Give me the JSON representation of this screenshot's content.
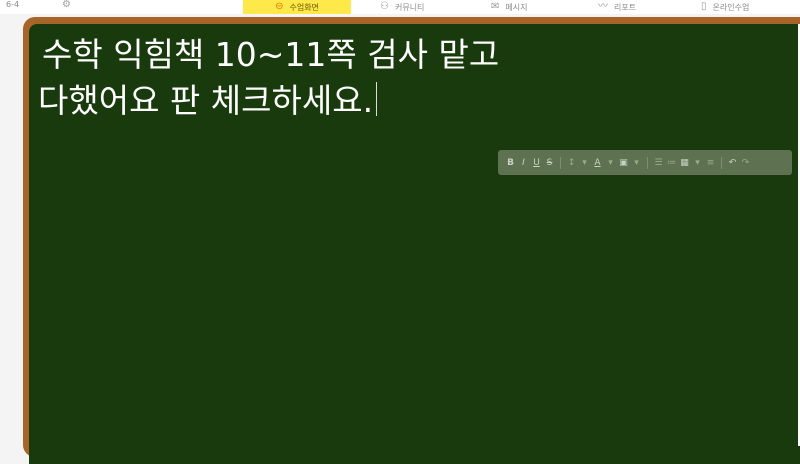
{
  "header": {
    "class_label": "6-4",
    "nav": [
      {
        "label": "수업화면",
        "icon": "class-screen-icon",
        "active": true
      },
      {
        "label": "커뮤니티",
        "icon": "community-icon",
        "active": false
      },
      {
        "label": "메시지",
        "icon": "message-icon",
        "active": false
      },
      {
        "label": "리포트",
        "icon": "report-icon",
        "active": false
      },
      {
        "label": "온라인수업",
        "icon": "online-class-icon",
        "active": false
      }
    ]
  },
  "board": {
    "line1": "수학 익힘책 10~11쪽 검사 맡고",
    "line2": "다했어요 판 체크하세요."
  },
  "toolbar": {
    "bold": "B",
    "italic": "I",
    "underline": "U",
    "strike": "S"
  },
  "colors": {
    "board_bg": "#183a0c",
    "frame": "#a8652a",
    "active_tab": "#ffe84a",
    "text": "#ffffff"
  }
}
